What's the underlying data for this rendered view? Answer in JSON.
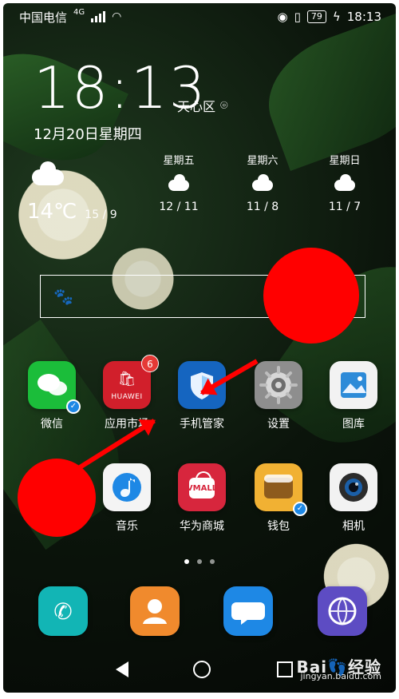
{
  "status_bar": {
    "carrier": "中国电信",
    "network": "4G",
    "battery": "79",
    "time": "18:13"
  },
  "lockscreen": {
    "clock": "18:13",
    "location": "天心区",
    "date": "12月20日星期四"
  },
  "weather": {
    "now": {
      "temp": "14℃",
      "range": "15 / 9",
      "icon": "cloudy-icon"
    },
    "forecast": [
      {
        "day": "星期五",
        "range": "12 / 11",
        "icon": "rain-cloud-icon"
      },
      {
        "day": "星期六",
        "range": "11 / 8",
        "icon": "rain-cloud-icon"
      },
      {
        "day": "星期日",
        "range": "11 / 7",
        "icon": "cloudy-icon"
      }
    ]
  },
  "search": {
    "icon": "baidu-paw-icon"
  },
  "apps_row1": [
    {
      "label": "微信",
      "color": "#1bbd3a",
      "icon": "wechat-icon"
    },
    {
      "label": "应用市场",
      "color": "#d11f2b",
      "icon": "huawei-appgallery-icon",
      "badge": "6",
      "logo_text": "HUAWEI"
    },
    {
      "label": "手机管家",
      "color": "#1565c0",
      "icon": "phone-manager-shield-icon"
    },
    {
      "label": "设置",
      "color": "#8e8e8e",
      "icon": "settings-gear-icon"
    },
    {
      "label": "图库",
      "color": "#f2f2f2",
      "icon": "gallery-icon"
    }
  ],
  "apps_row2": [
    {
      "label": "音乐",
      "color": "#f4f4f4",
      "icon": "music-icon"
    },
    {
      "label": "华为商城",
      "color": "#d7263d",
      "icon": "vmall-icon",
      "logo_text": "VMALL"
    },
    {
      "label": "钱包",
      "color": "#f1b133",
      "icon": "wallet-icon"
    },
    {
      "label": "相机",
      "color": "#f2f2f2",
      "icon": "camera-icon"
    }
  ],
  "dock": [
    {
      "icon": "phone-icon",
      "color": "#12b5b5"
    },
    {
      "icon": "contacts-icon",
      "color": "#f08a2d"
    },
    {
      "icon": "messages-icon",
      "color": "#1e88e5"
    },
    {
      "icon": "browser-icon",
      "color": "#5d4cc3"
    }
  ],
  "watermark": {
    "logo": "Bai👣经验",
    "url": "jingyan.baidu.com"
  },
  "accent": {
    "annotation_red": "#ff0000"
  }
}
